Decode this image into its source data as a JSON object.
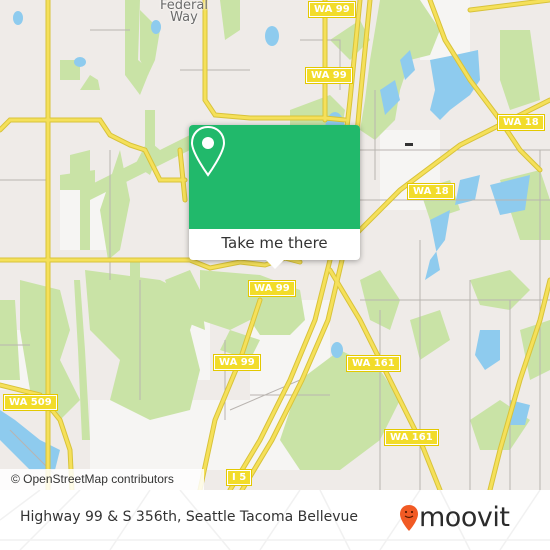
{
  "map": {
    "place_labels": [
      {
        "id": "federal-way",
        "text": "Federal\nWay"
      }
    ],
    "road_shields": [
      {
        "id": "wa99-top",
        "text": "WA 99"
      },
      {
        "id": "wa99-2",
        "text": "WA 99"
      },
      {
        "id": "wa18-1",
        "text": "WA 18"
      },
      {
        "id": "wa18-2",
        "text": "WA 18"
      },
      {
        "id": "wa99-3",
        "text": "WA 99"
      },
      {
        "id": "wa99-4",
        "text": "WA 99"
      },
      {
        "id": "wa509",
        "text": "WA 509"
      },
      {
        "id": "wa161-1",
        "text": "WA 161"
      },
      {
        "id": "wa161-2",
        "text": "WA 161"
      },
      {
        "id": "i5",
        "text": "I 5"
      }
    ],
    "attribution": "© OpenStreetMap contributors",
    "colors": {
      "land": "#efebe8",
      "park": "#c9e3a6",
      "water": "#8ecbee",
      "road": "#f5e05a",
      "road_edge": "#d8c33a",
      "minor_road": "#b9b4b0"
    }
  },
  "popup": {
    "icon": "map-pin-icon",
    "button_label": "Take me there",
    "accent_color": "#21b96b"
  },
  "footer": {
    "title": "Highway 99 & S 356th, Seattle Tacoma Bellevue",
    "brand": "moovit",
    "brand_icon": "moovit-smiley-pin-icon",
    "brand_color": "#f15a24"
  }
}
